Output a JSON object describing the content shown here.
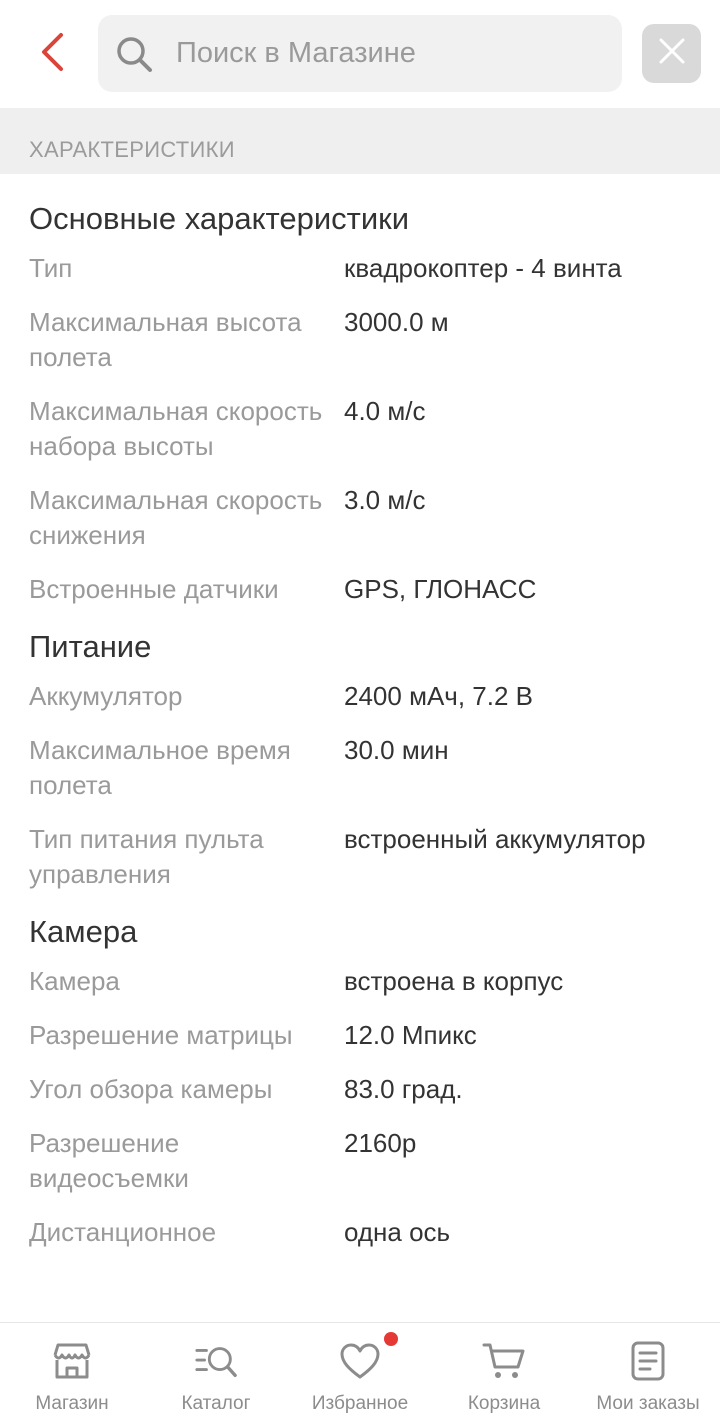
{
  "header": {
    "search_placeholder": "Поиск в Магазине",
    "back_icon": "chevron-left-icon",
    "clear_icon": "close-icon",
    "accent_color": "#d9443b"
  },
  "section": {
    "title": "ХАРАКТЕРИСТИКИ"
  },
  "groups": [
    {
      "title": "Основные характеристики",
      "rows": [
        {
          "label": "Тип",
          "value": "квадрокоптер - 4 винта"
        },
        {
          "label": "Максимальная высота полета",
          "value": "3000.0 м"
        },
        {
          "label": "Максимальная скорость набора высоты",
          "value": "4.0 м/с"
        },
        {
          "label": "Максимальная скорость снижения",
          "value": "3.0 м/с"
        },
        {
          "label": "Встроенные датчики",
          "value": "GPS, ГЛОНАСС"
        }
      ]
    },
    {
      "title": "Питание",
      "rows": [
        {
          "label": "Аккумулятор",
          "value": "2400 мАч, 7.2 В"
        },
        {
          "label": "Максимальное время полета",
          "value": "30.0 мин"
        },
        {
          "label": "Тип питания пульта управления",
          "value": "встроенный аккумулятор"
        }
      ]
    },
    {
      "title": "Камера",
      "rows": [
        {
          "label": "Камера",
          "value": "встроена в корпус"
        },
        {
          "label": "Разрешение матрицы",
          "value": "12.0 Мпикс"
        },
        {
          "label": "Угол обзора камеры",
          "value": "83.0 град."
        },
        {
          "label": "Разрешение видеосъемки",
          "value": "2160p"
        },
        {
          "label": "Дистанционное",
          "value": "одна ось"
        }
      ]
    }
  ],
  "bottom_nav": {
    "items": [
      {
        "label": "Магазин",
        "icon": "store-icon"
      },
      {
        "label": "Каталог",
        "icon": "catalog-search-icon"
      },
      {
        "label": "Избранное",
        "icon": "heart-icon",
        "badge_color": "#e53935"
      },
      {
        "label": "Корзина",
        "icon": "cart-icon"
      },
      {
        "label": "Мои заказы",
        "icon": "orders-list-icon"
      }
    ]
  }
}
